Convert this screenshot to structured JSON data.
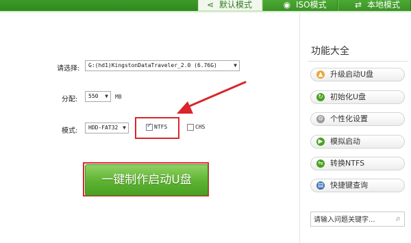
{
  "tabs": [
    {
      "label": "默认模式",
      "icon": "share-icon",
      "active": true
    },
    {
      "label": "ISO模式",
      "icon": "disc-icon",
      "active": false
    },
    {
      "label": "本地模式",
      "icon": "shuffle-icon",
      "active": false
    }
  ],
  "form": {
    "select_label": "请选择:",
    "device_value": "G:(hd1)KingstonDataTraveler_2.0 (6.76G)",
    "alloc_label": "分配:",
    "alloc_value": "550",
    "alloc_unit": "MB",
    "mode_label": "模式:",
    "mode_value": "HDD-FAT32",
    "ntfs_label": "NTFS",
    "ntfs_checked": true,
    "chs_label": "CHS",
    "chs_checked": false
  },
  "make_button_label": "一键制作启动U盘",
  "sidebar": {
    "title": "功能大全",
    "items": [
      {
        "label": "升级启动U盘",
        "icon": "folder-up-icon",
        "color": "#e8a93a"
      },
      {
        "label": "初始化U盘",
        "icon": "refresh-icon",
        "color": "#4aa022"
      },
      {
        "label": "个性化设置",
        "icon": "gear-icon",
        "color": "#9a9a9a"
      },
      {
        "label": "模拟启动",
        "icon": "play-icon",
        "color": "#4aa022"
      },
      {
        "label": "转换NTFS",
        "icon": "convert-icon",
        "color": "#4aa022"
      },
      {
        "label": "快捷键查询",
        "icon": "book-icon",
        "color": "#3b6fb0"
      }
    ],
    "search_placeholder": "请输入问题关键字..."
  },
  "colors": {
    "accent_green": "#4aa022",
    "highlight_red": "#d8262a"
  }
}
